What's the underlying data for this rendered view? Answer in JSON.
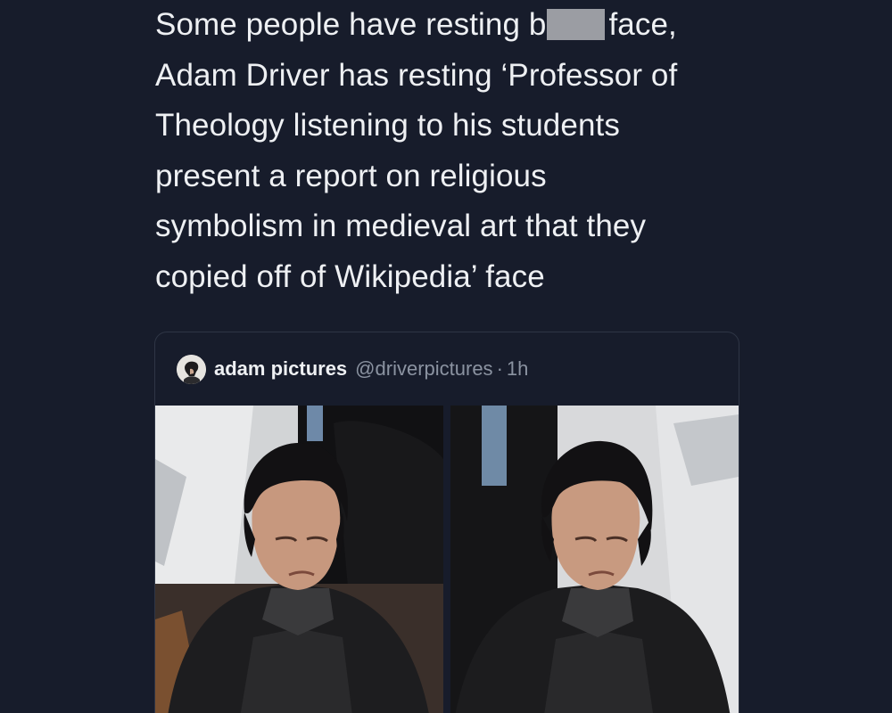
{
  "tweet": {
    "lines": [
      "Some people have resting b",
      "face,",
      "Adam Driver has resting ‘Professor of",
      "Theology listening to his students",
      "present a report on religious",
      "symbolism in medieval art that they",
      "copied off of Wikipedia’ face"
    ]
  },
  "quote": {
    "display_name": "adam pictures",
    "handle": "@driverpictures",
    "separator": "·",
    "time": "1h",
    "avatar_icon": "profile-avatar-icon",
    "photos": [
      {
        "icon": "photo-man-leather-jacket-1"
      },
      {
        "icon": "photo-man-leather-jacket-2"
      }
    ]
  },
  "colors": {
    "background": "#171c2b",
    "text": "#eef0f3",
    "muted": "#8b93a1",
    "censor": "#9b9da3",
    "border": "#2e3545"
  }
}
